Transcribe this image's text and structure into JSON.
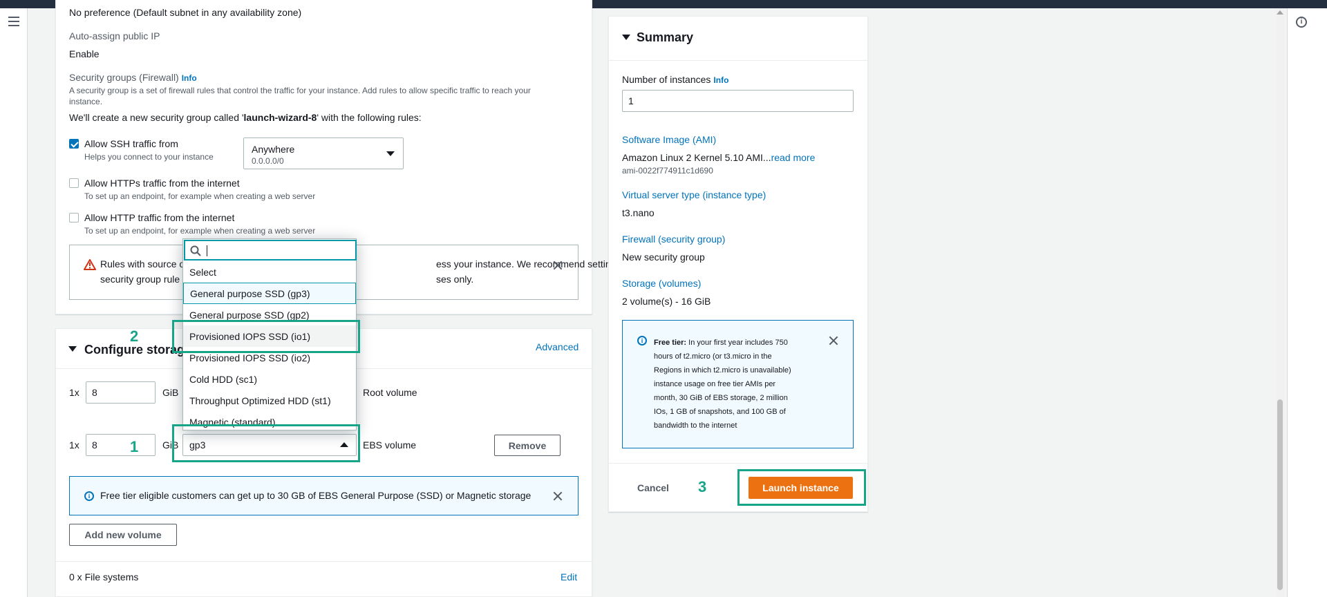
{
  "network": {
    "subnet_value": "No preference (Default subnet in any availability zone)",
    "auto_ip_label": "Auto-assign public IP",
    "auto_ip_value": "Enable",
    "sg_label": "Security groups (Firewall)",
    "info": "Info",
    "sg_desc": "A security group is a set of firewall rules that control the traffic for your instance. Add rules to allow specific traffic to reach your",
    "sg_desc2": "instance.",
    "sg_create_pre": "We'll create a new security group called '",
    "sg_name": "launch-wizard-8",
    "sg_create_post": "' with the following rules:",
    "ssh_label": "Allow SSH traffic from",
    "ssh_desc": "Helps you connect to your instance",
    "ssh_source": "Anywhere",
    "ssh_source_sub": "0.0.0.0/0",
    "https_label": "Allow HTTPs traffic from the internet",
    "https_desc": "To set up an endpoint, for example when creating a web server",
    "http_label": "Allow HTTP traffic from the internet",
    "http_desc": "To set up an endpoint, for example when creating a web server",
    "warn_line1a": "Rules with source o",
    "warn_line1b": "ess your instance. We recommend setting",
    "warn_line2a": "security group rule",
    "warn_line2b": "ses only."
  },
  "storage": {
    "title": "Configure storage",
    "advanced": "Advanced",
    "root_count": "1x",
    "root_size": "8",
    "unit": "GiB",
    "root_label": "Root volume",
    "ebs_count": "1x",
    "ebs_size": "8",
    "ebs_type": "gp3",
    "ebs_label": "EBS volume",
    "remove": "Remove",
    "free_tier_msg": "Free tier eligible customers can get up to 30 GB of EBS General Purpose (SSD) or Magnetic storage",
    "add_volume": "Add new volume",
    "file_systems": "0 x File systems",
    "edit": "Edit"
  },
  "dropdown": {
    "search_value": "",
    "options": [
      "Select",
      "General purpose SSD (gp3)",
      "General purpose SSD (gp2)",
      "Provisioned IOPS SSD (io1)",
      "Provisioned IOPS SSD (io2)",
      "Cold HDD (sc1)",
      "Throughput Optimized HDD (st1)",
      "Magnetic (standard)"
    ]
  },
  "summary": {
    "title": "Summary",
    "num_instances_label": "Number of instances",
    "info": "Info",
    "num_instances": "1",
    "ami_label": "Software Image (AMI)",
    "ami_value": "Amazon Linux 2 Kernel 5.10 AMI...",
    "read_more": "read more",
    "ami_id": "ami-0022f774911c1d690",
    "type_label": "Virtual server type (instance type)",
    "type_value": "t3.nano",
    "fw_label": "Firewall (security group)",
    "fw_value": "New security group",
    "storage_label": "Storage (volumes)",
    "storage_value": "2 volume(s) - 16 GiB",
    "free_tier_title": "Free tier:",
    "free_tier_lines": [
      "In your first year includes 750",
      "hours of t2.micro (or t3.micro in the",
      "Regions in which t2.micro is unavailable)",
      "instance usage on free tier AMIs per",
      "month, 30 GiB of EBS storage, 2 million",
      "IOs, 1 GB of snapshots, and 100 GB of",
      "bandwidth to the internet"
    ],
    "cancel": "Cancel",
    "launch": "Launch instance"
  },
  "annotations": {
    "n1": "1",
    "n2": "2",
    "n3": "3"
  },
  "colors": {
    "accent": "#0073bb",
    "primary_button": "#ec7211",
    "annotation": "#17a589",
    "topbar": "#232f3e"
  }
}
